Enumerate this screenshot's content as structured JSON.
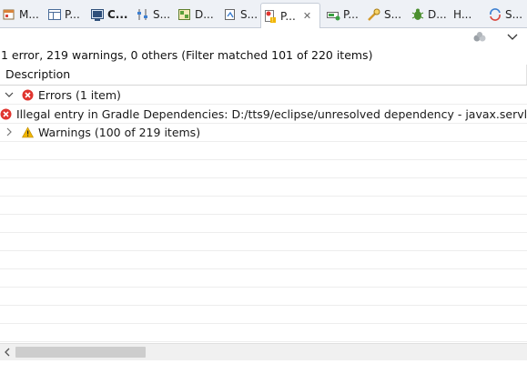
{
  "tabs": [
    {
      "label": "M...",
      "icon": "markers-icon"
    },
    {
      "label": "P...",
      "icon": "properties-icon"
    },
    {
      "label": "C...",
      "icon": "console-icon",
      "bold": true
    },
    {
      "label": "S...",
      "icon": "servers-icon"
    },
    {
      "label": "D...",
      "icon": "data-source-icon"
    },
    {
      "label": "S...",
      "icon": "snippets-icon"
    },
    {
      "label": "P...",
      "icon": "problems-icon",
      "active": true
    },
    {
      "label": "P...",
      "icon": "progress-icon"
    },
    {
      "label": "S...",
      "icon": "search-icon"
    },
    {
      "label": "D...",
      "icon": "debug-icon"
    },
    {
      "label": "H...",
      "icon": "history-icon"
    },
    {
      "label": "S...",
      "icon": "synchronize-icon"
    }
  ],
  "status": "1 error, 219 warnings, 0 others (Filter matched 101 of 220 items)",
  "table": {
    "header": "Description",
    "rows": [
      {
        "text": "Errors (1 item)",
        "level": 0,
        "expanded": true,
        "severity": "error"
      },
      {
        "text": "Illegal entry in Gradle Dependencies: D:/tts9/eclipse/unresolved dependency - javax.servl",
        "level": 1,
        "severity": "error"
      },
      {
        "text": "Warnings (100 of 219 items)",
        "level": 0,
        "expanded": false,
        "severity": "warning"
      }
    ]
  },
  "colors": {
    "error": "#e0352f",
    "warning": "#f2b600",
    "selection": "#ffffff"
  }
}
